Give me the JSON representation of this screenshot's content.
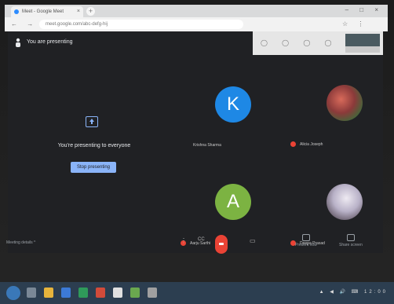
{
  "browser": {
    "tab_title": "Meet - Google Meet",
    "tab_close": "×",
    "new_tab": "+",
    "window_controls": "– □ ×",
    "nav_icons": "← → C",
    "url": "meet.google.com/abc-defg-hij",
    "extension_icons": "☆ ⋮"
  },
  "meeting": {
    "presenting_label": "You are presenting",
    "overlay_icons": "◯ ◯ ◯ ◯",
    "share_panel": {
      "message": "You're presenting to everyone",
      "stop_button": "Stop presenting"
    },
    "participants": [
      {
        "initial": "K",
        "name": "Krishna Sharma",
        "color": "#1e88e5",
        "type": "initial"
      },
      {
        "initial": "",
        "name": "Alicia Joseph",
        "color": "#8b3a3a",
        "type": "photo"
      },
      {
        "initial": "A",
        "name": "Aarju Sarthi",
        "color": "#7cb342",
        "type": "initial"
      },
      {
        "initial": "",
        "name": "Deepa Prasad",
        "color": "#c8c3d8",
        "type": "photo"
      }
    ],
    "bottom": {
      "details": "Meeting details  ^",
      "mic_icon": "🎤",
      "cc_icon": "CC",
      "cam_icon": "▭",
      "present_now": "Present now",
      "activities": "Share screen"
    }
  },
  "taskbar": {
    "tray": "▲ ◀ 🔊 ⌨ 12:00"
  },
  "colors": {
    "accent": "#8ab4f8",
    "hangup": "#ea4335",
    "background": "#202124"
  }
}
